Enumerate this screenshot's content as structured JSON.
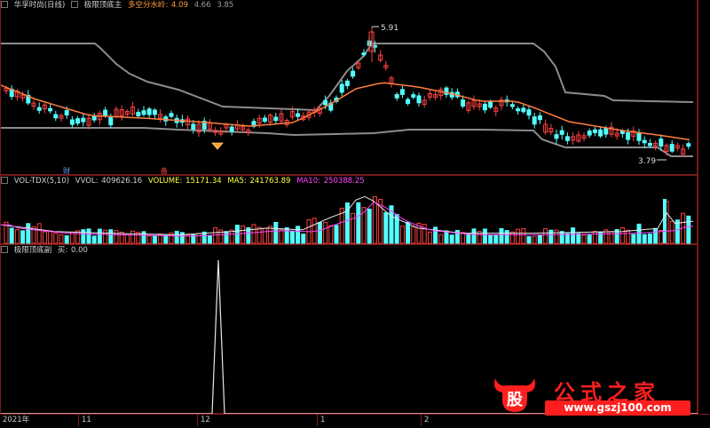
{
  "price_panel": {
    "title": "华孚时尚(日线)",
    "indicator": "极限顶底主",
    "divider_label": "多空分水岭:",
    "divider_value": "4.09",
    "v1": "4.66",
    "v2": "3.85",
    "high_label": "5.91",
    "low_label": "3.79",
    "marker_cai": "财",
    "marker_shen": "备"
  },
  "volume_panel": {
    "title": "VOL-TDX(5,10)",
    "vvol_label": "VVOL:",
    "vvol": "409626.16",
    "volume_label": "VOLUME:",
    "volume": "15171.34",
    "ma5_label": "MA5:",
    "ma5": "241763.89",
    "ma10_label": "MA10:",
    "ma10": "250388.25"
  },
  "indicator_panel": {
    "title": "极限顶底副",
    "buy_label": "买:",
    "buy_value": "0.00"
  },
  "time_axis": [
    "2021年",
    "11",
    "12",
    "1",
    "2"
  ],
  "watermark": {
    "logo_char": "股",
    "name": "公式之家",
    "url": "www.gszj100.com"
  },
  "colors": {
    "up": "#ff4040",
    "down": "#54ffff",
    "ma_orange": "#ff7f3f",
    "channel_gray": "#8c8c8c",
    "ma10_magenta": "#ff40ff",
    "label_orange": "#ff9a3a",
    "label_cyan": "#54ffff",
    "label_yellow": "#ffff40"
  }
}
